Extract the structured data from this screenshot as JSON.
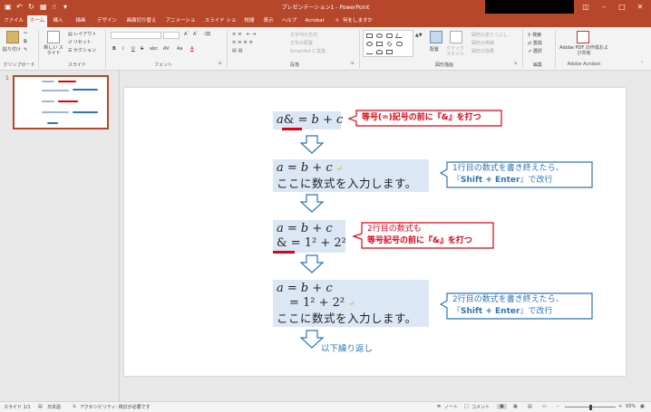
{
  "app": {
    "title": "プレゼンテーション1 - PowerPoint",
    "accent": "#b7472a"
  },
  "titlebar": {
    "icons": [
      "save-icon",
      "undo-icon",
      "redo-icon",
      "start-icon",
      "touch-icon",
      "customize-icon"
    ],
    "window_buttons": [
      "ribbon-display-icon",
      "minimize-icon",
      "restore-icon",
      "close-icon"
    ]
  },
  "tabs": [
    "ファイル",
    "ホーム",
    "挿入",
    "描画",
    "デザイン",
    "画面切り替え",
    "アニメーション",
    "スライド ショー",
    "校閲",
    "表示",
    "ヘルプ",
    "Acrobat"
  ],
  "tell_me": "何をしますか",
  "ribbon": {
    "clipboard": {
      "paste": "貼り付け",
      "label": "クリップボード"
    },
    "slides": {
      "new_slide": "新しい スライド",
      "layout": "レイアウト",
      "reset": "リセット",
      "section": "セクション",
      "label": "スライド"
    },
    "font": {
      "bold": "B",
      "italic": "I",
      "underline": "U",
      "strike": "S",
      "shadow": "abc",
      "spacing": "AV",
      "case": "Aa",
      "color": "A",
      "label": "フォント"
    },
    "paragraph": {
      "direction": "文字列の方向",
      "align": "文字の配置",
      "smartart": "SmartArt に変換",
      "label": "段落"
    },
    "drawing": {
      "arrange": "配置",
      "quick_styles": "クイック スタイル",
      "fill": "図形の塗りつぶし",
      "outline": "図形の枠線",
      "effects": "図形の効果",
      "label": "図形描画"
    },
    "editing": {
      "find": "検索",
      "replace": "置換",
      "select": "選択",
      "label": "編集"
    },
    "acrobat": {
      "create": "Adobe PDF の作成および共有",
      "label": "Adobe Acrobat"
    }
  },
  "thumbnail": {
    "number": "1"
  },
  "slide": {
    "step1": {
      "math_a": "a",
      "amp": "&",
      "eq": "=",
      "rest": "b + c"
    },
    "callout1": "等号(=)記号の前に『&』を打つ",
    "step2": {
      "line1": "a = b + c",
      "return": "↵",
      "line2": "ここに数式を入力します。"
    },
    "callout2": {
      "line1": "1行目の数式を書き終えたら、",
      "line2_a": "『",
      "line2_b": "Shift + Enter",
      "line2_c": "』で改行"
    },
    "step3": {
      "line1": "a = b + c",
      "amp": "&",
      "rest": "= 1² + 2²"
    },
    "callout3": {
      "line1": "2行目の数式も",
      "line2": "等号記号の前に『&』を打つ"
    },
    "step4": {
      "line1": "a = b + c",
      "line2": "= 1² + 2²",
      "return": "↵",
      "line3": "ここに数式を入力します。"
    },
    "callout4": {
      "line1": "2行目の数式を書き終えたら、",
      "line2_a": "『",
      "line2_b": "Shift + Enter",
      "line2_c": "』で改行"
    },
    "repeat": "以下繰り返し",
    "colors": {
      "box": "#dbe7f4",
      "red": "#e00012",
      "blue": "#2e75b6"
    }
  },
  "status": {
    "slide": "スライド 1/1",
    "lang": "日本語",
    "accessibility": "アクセシビリティ: 検討が必要です",
    "notes": "ノート",
    "comments": "コメント",
    "zoom": "93%"
  }
}
